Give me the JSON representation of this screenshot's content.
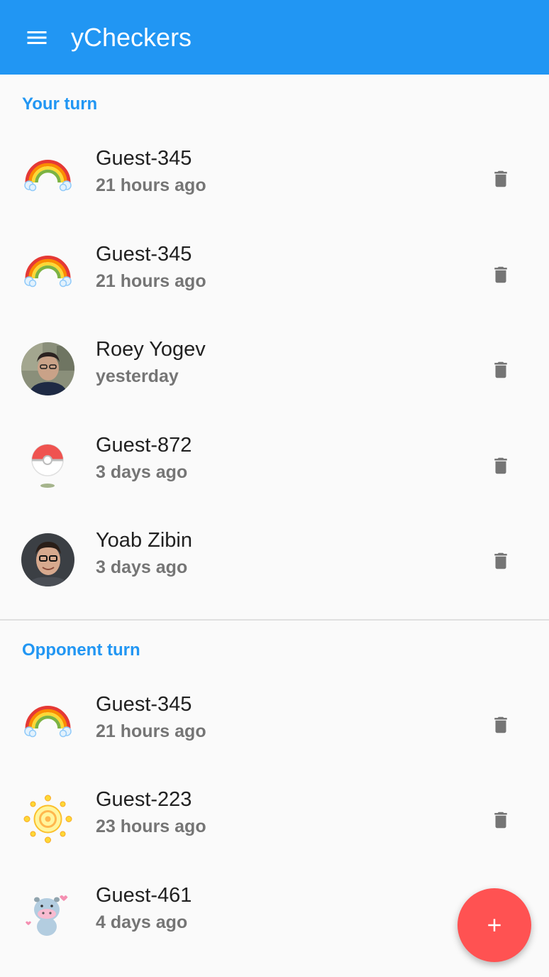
{
  "app": {
    "title": "yCheckers",
    "menu_icon": "menu-icon",
    "primary_color": "#2196f3",
    "accent_color": "#ff5252"
  },
  "sections": [
    {
      "header": "Your turn",
      "games": [
        {
          "opponent": "Guest-345",
          "time": "21 hours ago",
          "avatar": "rainbow-avatar"
        },
        {
          "opponent": "Guest-345",
          "time": "21 hours ago",
          "avatar": "rainbow-avatar"
        },
        {
          "opponent": "Roey Yogev",
          "time": "yesterday",
          "avatar": "photo-avatar"
        },
        {
          "opponent": "Guest-872",
          "time": "3 days ago",
          "avatar": "pokeball-avatar"
        },
        {
          "opponent": "Yoab Zibin",
          "time": "3 days ago",
          "avatar": "photo-avatar"
        }
      ]
    },
    {
      "header": "Opponent turn",
      "games": [
        {
          "opponent": "Guest-345",
          "time": "21 hours ago",
          "avatar": "rainbow-avatar"
        },
        {
          "opponent": "Guest-223",
          "time": "23 hours ago",
          "avatar": "sun-avatar"
        },
        {
          "opponent": "Guest-461",
          "time": "4 days ago",
          "avatar": "hippo-avatar"
        }
      ]
    }
  ],
  "actions": {
    "delete_icon": "trash-icon",
    "new_game_icon": "plus-icon"
  }
}
